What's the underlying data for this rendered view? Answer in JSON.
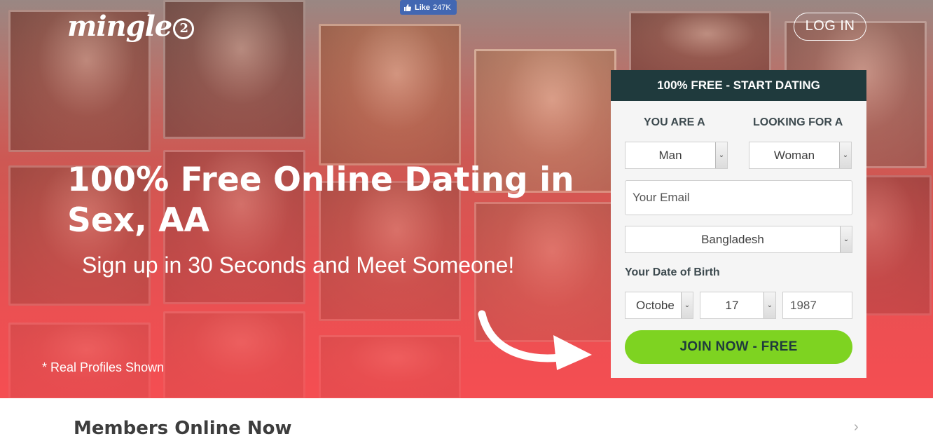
{
  "header": {
    "logo_text": "mingle",
    "logo_number": "2",
    "fb_like_label": "Like",
    "fb_like_count": "247K",
    "login_label": "LOG IN"
  },
  "hero": {
    "headline": "100% Free Online Dating in Sex, AA",
    "subheadline": "Sign up in 30 Seconds and Meet Someone!",
    "footnote": "* Real Profiles Shown"
  },
  "signup": {
    "title": "100% FREE - START DATING",
    "you_are_label": "YOU ARE A",
    "looking_for_label": "LOOKING FOR A",
    "you_are_value": "Man",
    "looking_for_value": "Woman",
    "email_placeholder": "Your Email",
    "country_value": "Bangladesh",
    "dob_label": "Your Date of Birth",
    "dob_month": "Octobe",
    "dob_day": "17",
    "dob_year": "1987",
    "join_label": "JOIN NOW - FREE"
  },
  "members": {
    "title": "Members Online Now"
  },
  "colors": {
    "panel_header": "#1f3a3d",
    "join_button": "#7ed321",
    "hero_bottom": "#f24d53",
    "fb_blue": "#4267b2"
  }
}
